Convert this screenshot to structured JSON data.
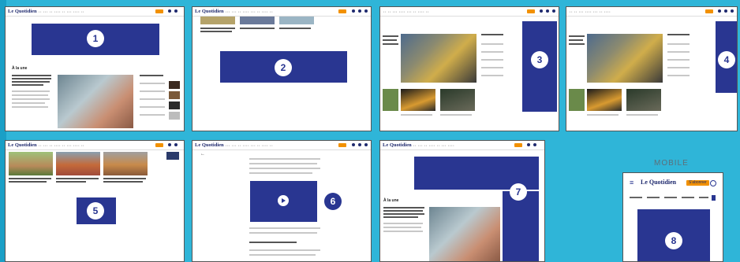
{
  "labels": {
    "mobile": "MOBILE"
  },
  "common": {
    "logo": "Le Quotidien",
    "subscribe": "S'abonner"
  },
  "panels": {
    "p1": {
      "number": "1",
      "section_title": "À la une"
    },
    "p2": {
      "number": "2"
    },
    "p3": {
      "number": "3"
    },
    "p4": {
      "number": "4"
    },
    "p5": {
      "number": "5"
    },
    "p6": {
      "number": "6"
    },
    "p7": {
      "number": "7",
      "section_title": "À la une"
    },
    "p8": {
      "number": "8"
    }
  },
  "colors": {
    "background": "#2fb5d8",
    "ad_block": "#293691",
    "accent": "#f29100",
    "brand": "#1f2a6e"
  },
  "icons": {
    "play": "play-icon"
  }
}
